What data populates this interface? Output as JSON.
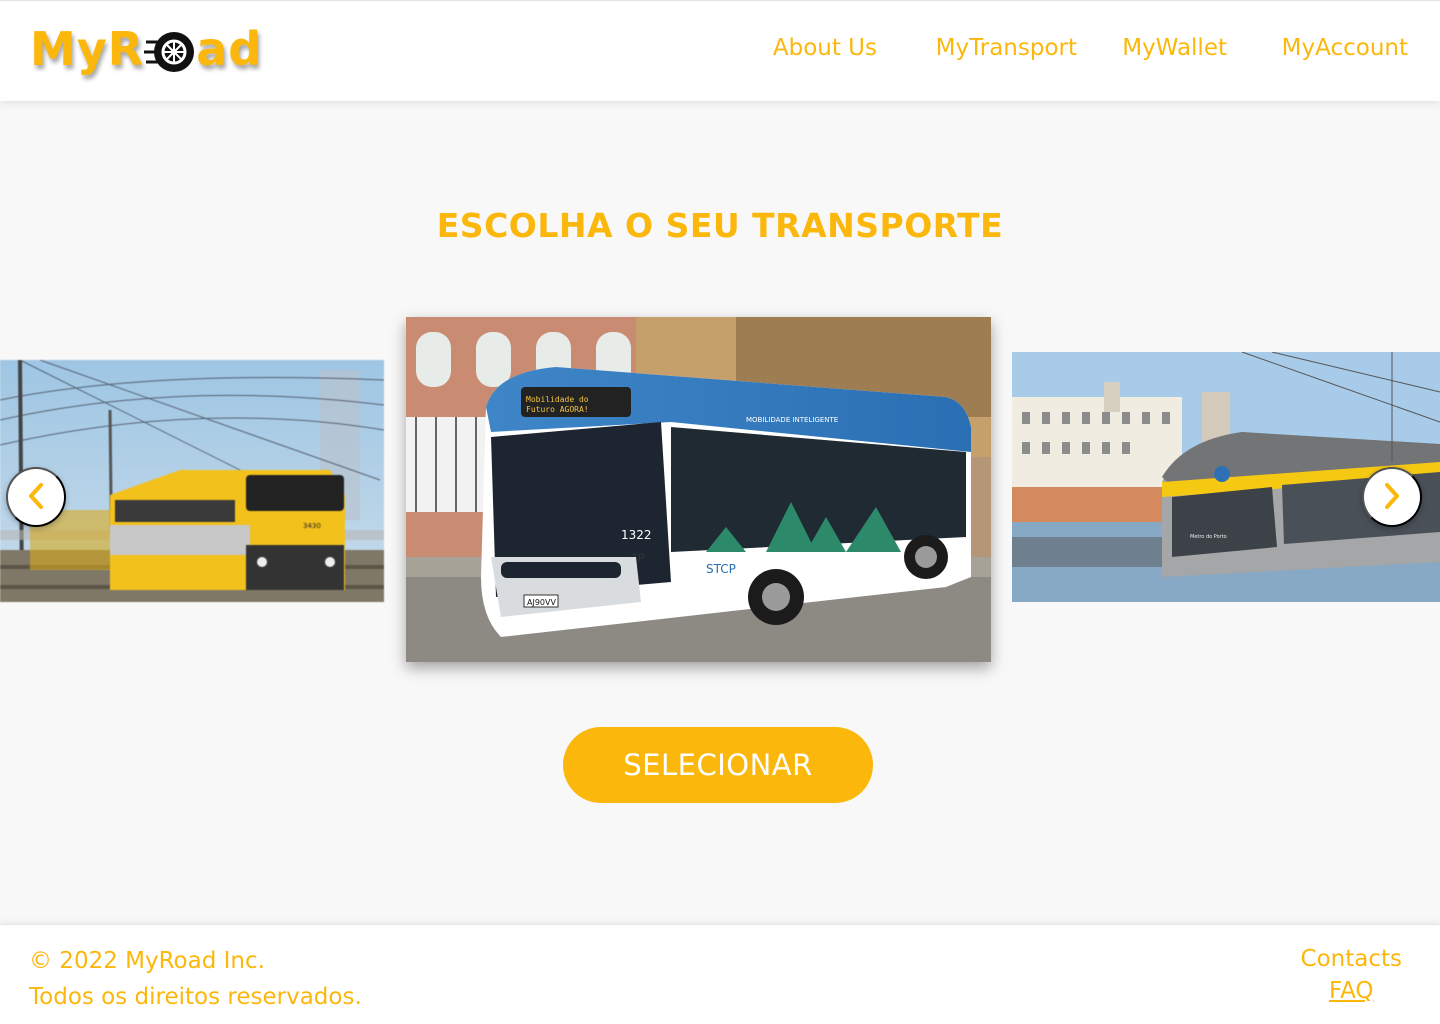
{
  "header": {
    "logo_left": "MyR",
    "logo_right": "ad",
    "nav": [
      {
        "label": "About Us"
      },
      {
        "label": "MyTransport"
      },
      {
        "label": "MyWallet"
      },
      {
        "label": "MyAccount"
      }
    ]
  },
  "main": {
    "title": "ESCOLHA O SEU TRANSPORTE",
    "carousel": {
      "slides": [
        {
          "kind": "train",
          "icon": "train-image",
          "texts": {
            "number": "3430"
          }
        },
        {
          "kind": "bus",
          "icon": "bus-image",
          "texts": {
            "destination_1": "Mobilidade do",
            "destination_2": "Futuro AGORA!",
            "fleet_number": "1322",
            "operator": "STCP",
            "badge": "TP",
            "plate": "AJ90VV",
            "side_text": "MOBILIDADE INTELIGENTE"
          }
        },
        {
          "kind": "metro",
          "icon": "metro-image",
          "texts": {
            "side_text": "Metro do Porto"
          }
        }
      ],
      "prev_icon": "chevron-left-icon",
      "next_icon": "chevron-right-icon"
    },
    "select_label": "SELECIONAR"
  },
  "footer": {
    "copyright": "© 2022 MyRoad Inc.",
    "rights": "Todos os direitos reservados.",
    "contacts": "Contacts",
    "faq": "FAQ"
  },
  "colors": {
    "accent": "#fbb70b",
    "background": "#f8f8f8",
    "header_bg": "#ffffff"
  }
}
